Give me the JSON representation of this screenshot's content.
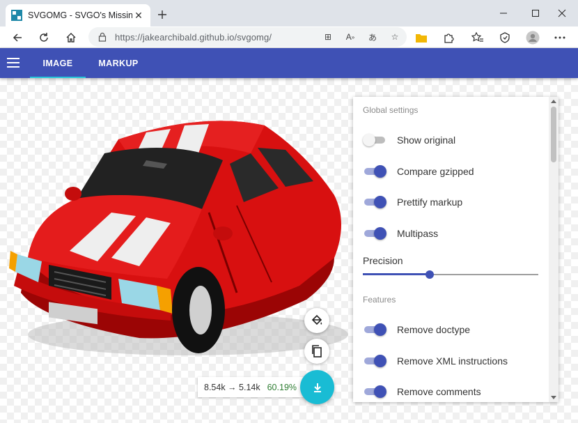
{
  "browser": {
    "tab_title": "SVGOMG - SVGO's Missing GUI",
    "url": "https://jakearchibald.github.io/svgomg/"
  },
  "app": {
    "tabs": [
      {
        "label": "IMAGE",
        "active": true
      },
      {
        "label": "MARKUP",
        "active": false
      }
    ]
  },
  "results": {
    "sizes": "8.54k → 5.14k",
    "percent": "60.19%"
  },
  "settings": {
    "global_title": "Global settings",
    "global": [
      {
        "label": "Show original",
        "on": false
      },
      {
        "label": "Compare gzipped",
        "on": true
      },
      {
        "label": "Prettify markup",
        "on": true
      },
      {
        "label": "Multipass",
        "on": true
      }
    ],
    "precision": {
      "label": "Precision",
      "value": 0.38
    },
    "features_title": "Features",
    "features": [
      {
        "label": "Remove doctype",
        "on": true
      },
      {
        "label": "Remove XML instructions",
        "on": true
      },
      {
        "label": "Remove comments",
        "on": true
      }
    ]
  },
  "colors": {
    "primary": "#3f51b5",
    "accent": "#19bcd4",
    "savings": "#2e7d32"
  }
}
